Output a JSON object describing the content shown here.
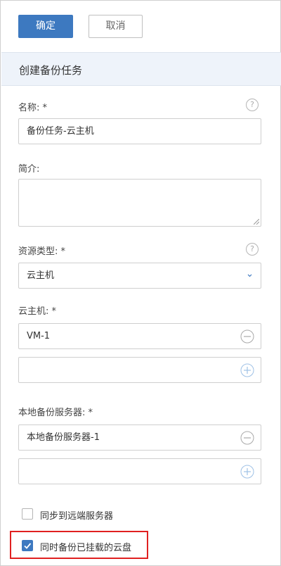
{
  "toolbar": {
    "confirm_label": "确定",
    "cancel_label": "取消"
  },
  "section": {
    "title": "创建备份任务"
  },
  "form": {
    "name": {
      "label": "名称: *",
      "value": "备份任务-云主机"
    },
    "description": {
      "label": "简介:",
      "value": ""
    },
    "resource_type": {
      "label": "资源类型: *",
      "value": "云主机"
    },
    "vm": {
      "label": "云主机: *",
      "items": [
        "VM-1",
        ""
      ]
    },
    "backup_server": {
      "label": "本地备份服务器: *",
      "items": [
        "本地备份服务器-1",
        ""
      ]
    },
    "sync_remote": {
      "label": "同步到远端服务器",
      "checked": false
    },
    "backup_attached_disks": {
      "label": "同时备份已挂载的云盘",
      "checked": true
    }
  },
  "icons": {
    "help": "question-circle-icon",
    "dropdown": "chevron-down-icon",
    "remove": "minus-circle-icon",
    "add": "plus-circle-icon",
    "check": "checkmark-icon"
  },
  "help_glyph": "?",
  "colors": {
    "primary": "#3d79c0",
    "highlight": "#e02020",
    "header_bg": "#eef3fa"
  }
}
